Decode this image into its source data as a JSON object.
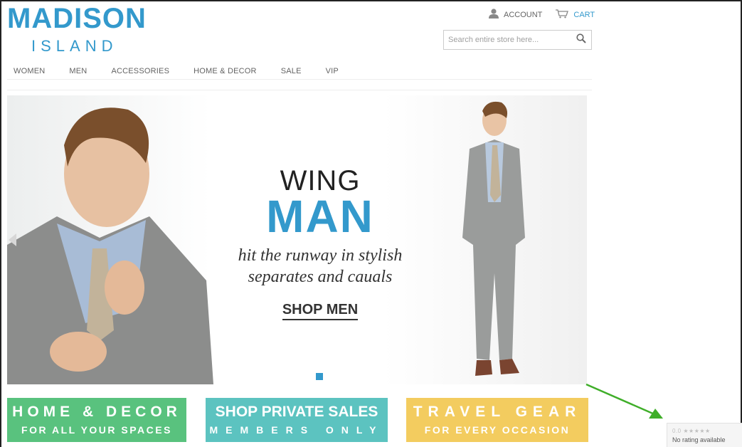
{
  "brand": {
    "line1": "MADISON",
    "line2": "ISLAND"
  },
  "header": {
    "account_label": "ACCOUNT",
    "cart_label": "CART",
    "search_placeholder": "Search entire store here..."
  },
  "nav": {
    "items": [
      {
        "label": "WOMEN"
      },
      {
        "label": "MEN"
      },
      {
        "label": "ACCESSORIES"
      },
      {
        "label": "HOME & DECOR"
      },
      {
        "label": "SALE"
      },
      {
        "label": "VIP"
      }
    ]
  },
  "hero": {
    "line1": "WING",
    "line2": "MAN",
    "tagline1": "hit the runway in stylish",
    "tagline2": "separates and cauals",
    "cta": "SHOP MEN"
  },
  "promos": [
    {
      "line1": "HOME & DECOR",
      "line2": "FOR ALL YOUR SPACES",
      "color": "#59c27e"
    },
    {
      "line1": "SHOP PRIVATE SALES",
      "line2": "MEMBERS ONLY",
      "color": "#5cc3c0"
    },
    {
      "line1": "TRAVEL GEAR",
      "line2": "FOR EVERY OCCASION",
      "color": "#f3cc5f"
    }
  ],
  "rating_widget": {
    "score": "0.0 ★★★★★",
    "text": "No rating available"
  },
  "colors": {
    "brand_blue": "#3399cc",
    "annotation_arrow": "#3fae29"
  },
  "icons": {
    "account": "user-icon",
    "cart": "cart-icon",
    "search": "search-icon",
    "prev": "chevron-left-icon"
  }
}
